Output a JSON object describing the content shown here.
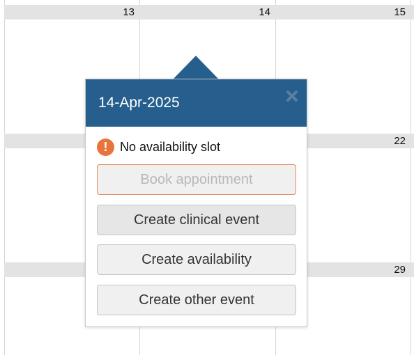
{
  "calendar": {
    "week1": [
      "13",
      "14",
      "15"
    ],
    "week2": [
      "22"
    ],
    "week3": [
      "29"
    ]
  },
  "popup": {
    "date": "14-Apr-2025",
    "close_icon": "close-x-icon",
    "status_icon": "warning-icon",
    "status_icon_glyph": "!",
    "status_text": "No availability slot",
    "buttons": {
      "book": "Book appointment",
      "clinical": "Create clinical event",
      "availability": "Create availability",
      "other": "Create other event"
    },
    "colors": {
      "header": "#265f8e",
      "warning": "#e8743b",
      "disabled_border": "#e08a55"
    }
  }
}
